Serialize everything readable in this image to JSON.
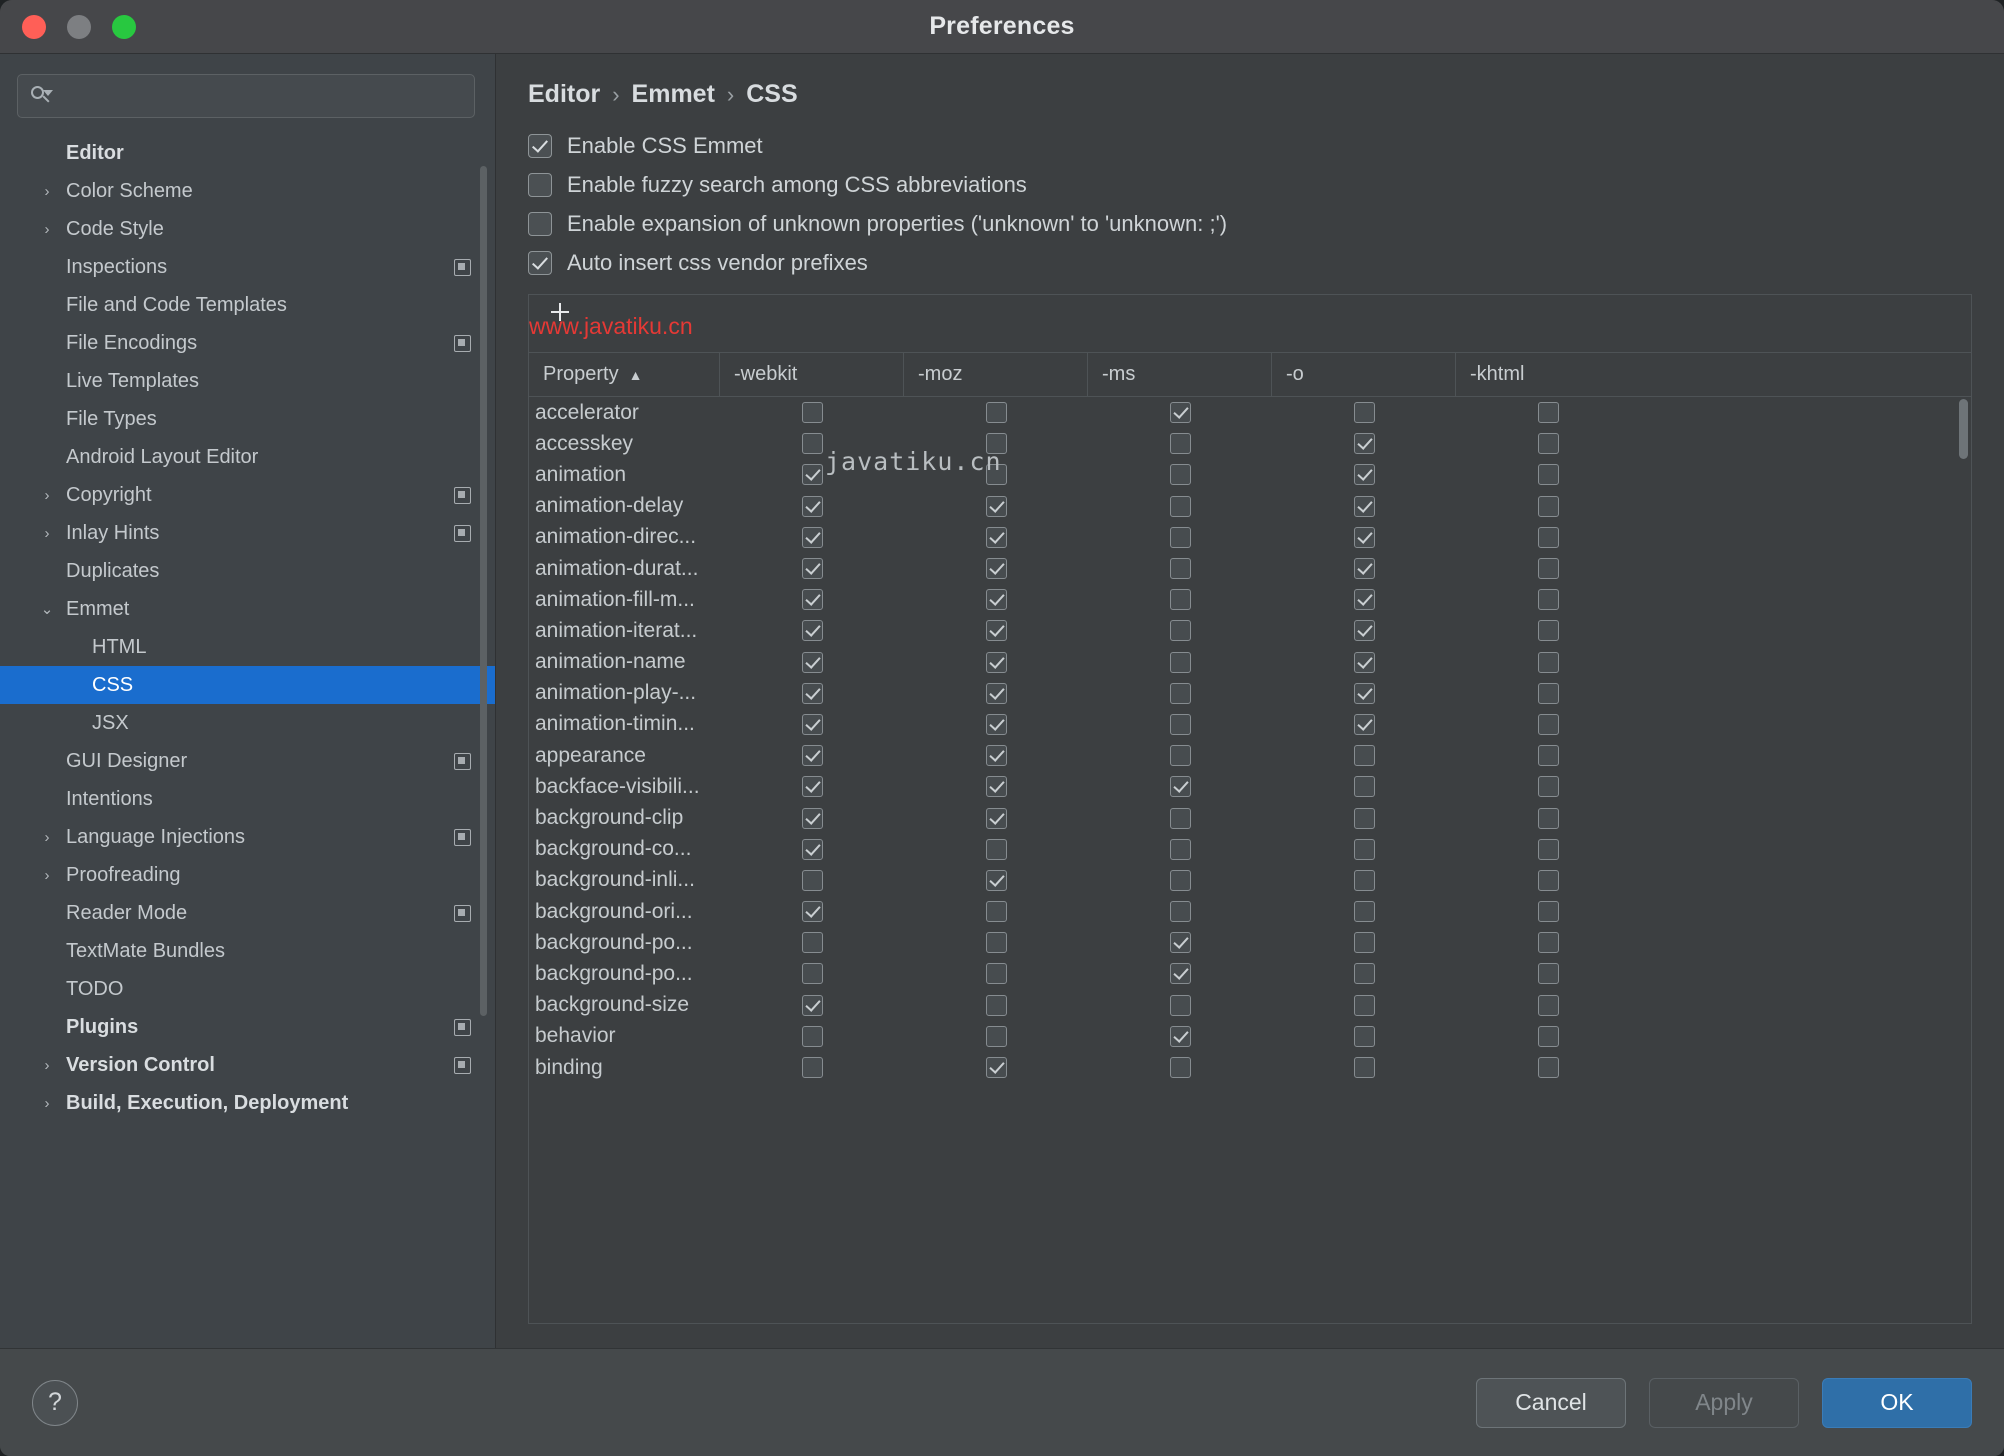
{
  "window": {
    "title": "Preferences"
  },
  "search": {
    "value": "",
    "placeholder": ""
  },
  "sidebar": {
    "items": [
      {
        "label": "Editor",
        "level": 0,
        "arrow": "",
        "bold": true,
        "badge": false,
        "selected": false
      },
      {
        "label": "Color Scheme",
        "level": 1,
        "arrow": "›",
        "bold": false,
        "badge": false,
        "selected": false
      },
      {
        "label": "Code Style",
        "level": 1,
        "arrow": "›",
        "bold": false,
        "badge": false,
        "selected": false
      },
      {
        "label": "Inspections",
        "level": 1,
        "arrow": "",
        "bold": false,
        "badge": true,
        "selected": false
      },
      {
        "label": "File and Code Templates",
        "level": 1,
        "arrow": "",
        "bold": false,
        "badge": false,
        "selected": false
      },
      {
        "label": "File Encodings",
        "level": 1,
        "arrow": "",
        "bold": false,
        "badge": true,
        "selected": false
      },
      {
        "label": "Live Templates",
        "level": 1,
        "arrow": "",
        "bold": false,
        "badge": false,
        "selected": false
      },
      {
        "label": "File Types",
        "level": 1,
        "arrow": "",
        "bold": false,
        "badge": false,
        "selected": false
      },
      {
        "label": "Android Layout Editor",
        "level": 1,
        "arrow": "",
        "bold": false,
        "badge": false,
        "selected": false
      },
      {
        "label": "Copyright",
        "level": 1,
        "arrow": "›",
        "bold": false,
        "badge": true,
        "selected": false
      },
      {
        "label": "Inlay Hints",
        "level": 1,
        "arrow": "›",
        "bold": false,
        "badge": true,
        "selected": false
      },
      {
        "label": "Duplicates",
        "level": 1,
        "arrow": "",
        "bold": false,
        "badge": false,
        "selected": false
      },
      {
        "label": "Emmet",
        "level": 1,
        "arrow": "⌄",
        "bold": false,
        "badge": false,
        "selected": false
      },
      {
        "label": "HTML",
        "level": 2,
        "arrow": "",
        "bold": false,
        "badge": false,
        "selected": false
      },
      {
        "label": "CSS",
        "level": 2,
        "arrow": "",
        "bold": false,
        "badge": false,
        "selected": true
      },
      {
        "label": "JSX",
        "level": 2,
        "arrow": "",
        "bold": false,
        "badge": false,
        "selected": false
      },
      {
        "label": "GUI Designer",
        "level": 1,
        "arrow": "",
        "bold": false,
        "badge": true,
        "selected": false
      },
      {
        "label": "Intentions",
        "level": 1,
        "arrow": "",
        "bold": false,
        "badge": false,
        "selected": false
      },
      {
        "label": "Language Injections",
        "level": 1,
        "arrow": "›",
        "bold": false,
        "badge": true,
        "selected": false
      },
      {
        "label": "Proofreading",
        "level": 1,
        "arrow": "›",
        "bold": false,
        "badge": false,
        "selected": false
      },
      {
        "label": "Reader Mode",
        "level": 1,
        "arrow": "",
        "bold": false,
        "badge": true,
        "selected": false
      },
      {
        "label": "TextMate Bundles",
        "level": 1,
        "arrow": "",
        "bold": false,
        "badge": false,
        "selected": false
      },
      {
        "label": "TODO",
        "level": 1,
        "arrow": "",
        "bold": false,
        "badge": false,
        "selected": false
      },
      {
        "label": "Plugins",
        "level": 0,
        "arrow": "",
        "bold": true,
        "badge": true,
        "selected": false
      },
      {
        "label": "Version Control",
        "level": 0,
        "arrow": "›",
        "bold": true,
        "badge": true,
        "selected": false
      },
      {
        "label": "Build, Execution, Deployment",
        "level": 0,
        "arrow": "›",
        "bold": true,
        "badge": false,
        "selected": false
      }
    ]
  },
  "main": {
    "breadcrumb": [
      "Editor",
      "Emmet",
      "CSS"
    ],
    "breadcrumb_separator": "›",
    "options": [
      {
        "label": "Enable CSS Emmet",
        "checked": true
      },
      {
        "label": "Enable fuzzy search among CSS abbreviations",
        "checked": false
      },
      {
        "label": "Enable expansion of unknown properties ('unknown' to 'unknown: ;')",
        "checked": false
      },
      {
        "label": "Auto insert css vendor prefixes",
        "checked": true
      }
    ],
    "watermark_top": "www.javatiku.cn",
    "watermark_mid": "javatiku.cn",
    "table": {
      "columns": [
        "Property",
        "-webkit",
        "-moz",
        "-ms",
        "-o",
        "-khtml"
      ],
      "sort_column": "Property",
      "sort_arrow": "▲",
      "rows": [
        {
          "property": "accelerator",
          "values": [
            false,
            false,
            true,
            false,
            false
          ]
        },
        {
          "property": "accesskey",
          "values": [
            false,
            false,
            false,
            true,
            false
          ]
        },
        {
          "property": "animation",
          "values": [
            true,
            false,
            false,
            true,
            false
          ]
        },
        {
          "property": "animation-delay",
          "values": [
            true,
            true,
            false,
            true,
            false
          ]
        },
        {
          "property": "animation-direc...",
          "values": [
            true,
            true,
            false,
            true,
            false
          ]
        },
        {
          "property": "animation-durat...",
          "values": [
            true,
            true,
            false,
            true,
            false
          ]
        },
        {
          "property": "animation-fill-m...",
          "values": [
            true,
            true,
            false,
            true,
            false
          ]
        },
        {
          "property": "animation-iterat...",
          "values": [
            true,
            true,
            false,
            true,
            false
          ]
        },
        {
          "property": "animation-name",
          "values": [
            true,
            true,
            false,
            true,
            false
          ]
        },
        {
          "property": "animation-play-...",
          "values": [
            true,
            true,
            false,
            true,
            false
          ]
        },
        {
          "property": "animation-timin...",
          "values": [
            true,
            true,
            false,
            true,
            false
          ]
        },
        {
          "property": "appearance",
          "values": [
            true,
            true,
            false,
            false,
            false
          ]
        },
        {
          "property": "backface-visibili...",
          "values": [
            true,
            true,
            true,
            false,
            false
          ]
        },
        {
          "property": "background-clip",
          "values": [
            true,
            true,
            false,
            false,
            false
          ]
        },
        {
          "property": "background-co...",
          "values": [
            true,
            false,
            false,
            false,
            false
          ]
        },
        {
          "property": "background-inli...",
          "values": [
            false,
            true,
            false,
            false,
            false
          ]
        },
        {
          "property": "background-ori...",
          "values": [
            true,
            false,
            false,
            false,
            false
          ]
        },
        {
          "property": "background-po...",
          "values": [
            false,
            false,
            true,
            false,
            false
          ]
        },
        {
          "property": "background-po...",
          "values": [
            false,
            false,
            true,
            false,
            false
          ]
        },
        {
          "property": "background-size",
          "values": [
            true,
            false,
            false,
            false,
            false
          ]
        },
        {
          "property": "behavior",
          "values": [
            false,
            false,
            true,
            false,
            false
          ]
        },
        {
          "property": "binding",
          "values": [
            false,
            true,
            false,
            false,
            false
          ]
        }
      ]
    }
  },
  "footer": {
    "help_label": "?",
    "cancel_label": "Cancel",
    "apply_label": "Apply",
    "ok_label": "OK"
  },
  "colors": {
    "accent": "#1a6dce",
    "primary_button": "#2f6fa8",
    "watermark": "#e53935"
  }
}
